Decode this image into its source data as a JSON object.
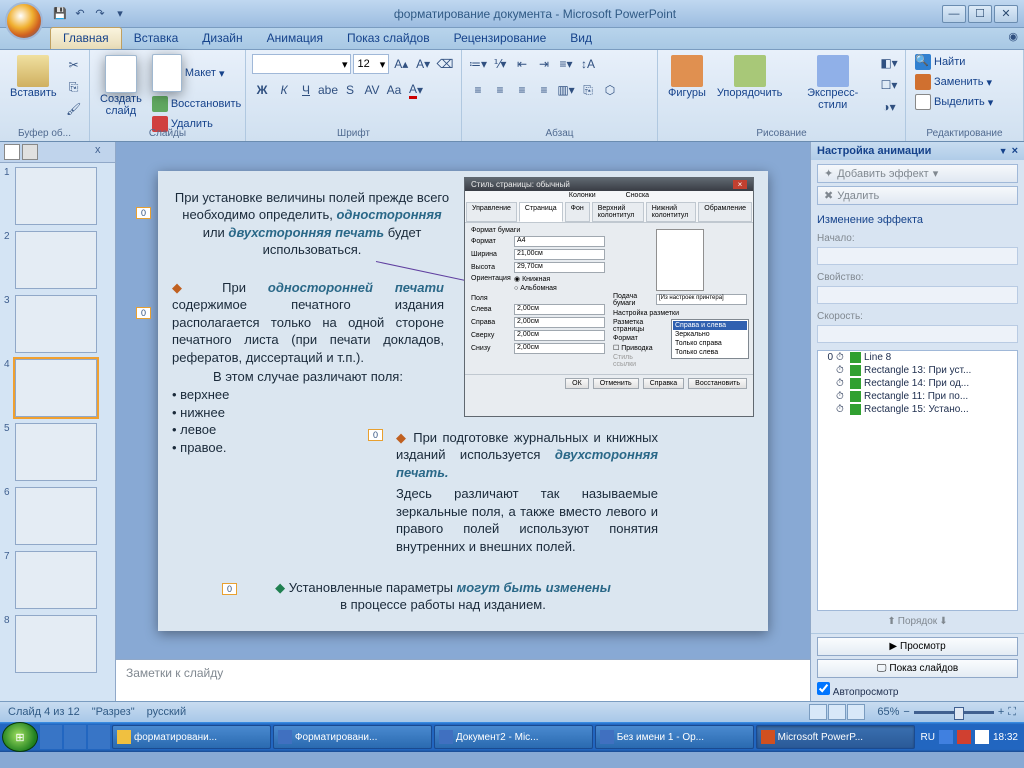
{
  "title": "форматирование документа - Microsoft PowerPoint",
  "qat": {
    "save": "💾",
    "undo": "↶",
    "redo": "↷",
    "dd": "▾"
  },
  "winbtns": {
    "min": "—",
    "max": "☐",
    "close": "✕"
  },
  "tabs": [
    "Главная",
    "Вставка",
    "Дизайн",
    "Анимация",
    "Показ слайдов",
    "Рецензирование",
    "Вид"
  ],
  "ribbon": {
    "clipboard": {
      "label": "Буфер об...",
      "paste": "Вставить"
    },
    "slides": {
      "label": "Слайды",
      "new": "Создать\nслайд",
      "layout": "Макет",
      "reset": "Восстановить",
      "delete": "Удалить"
    },
    "font": {
      "label": "Шрифт",
      "name": "",
      "size": "12"
    },
    "para": {
      "label": "Абзац"
    },
    "draw": {
      "label": "Рисование",
      "shapes": "Фигуры",
      "arrange": "Упорядочить",
      "quick": "Экспресс-стили"
    },
    "edit": {
      "label": "Редактирование",
      "find": "Найти",
      "replace": "Заменить",
      "select": "Выделить"
    }
  },
  "outline": {
    "close": "x"
  },
  "slide_count": 12,
  "selected_slide": 4,
  "slide": {
    "p1a": "При установке величины полей прежде всего необходимо определить, ",
    "p1b": "односторонняя",
    "p1c": " или ",
    "p1d": "двухсторонняя печать",
    "p1e": " будет использоваться.",
    "p2a": "При ",
    "p2b": "односторонней печати",
    "p2c": " содержимое печатного издания располагается только на одной стороне печатного листа (при печати докладов, рефератов, диссертаций и т.п.).",
    "p3": "В этом случае различают поля:",
    "b1": "• верхнее",
    "b2": "• нижнее",
    "b3": "• левое",
    "b4": "• правое.",
    "p4a": "При подготовке журнальных и книжных изданий используется ",
    "p4b": "двухсторонняя печать.",
    "p5": "Здесь различают так называемые зеркальные поля, а также вместо левого и правого полей используют понятия внутренних и внешних полей.",
    "p6a": "Установленные параметры ",
    "p6b": "могут быть изменены",
    "p6c": " в процессе работы над изданием.",
    "tags": [
      "0",
      "0",
      "0",
      "0"
    ]
  },
  "dialog": {
    "title": "Стиль страницы: обычный",
    "tabs": [
      "Управление",
      "Страница",
      "Фон",
      "Верхний колонтитул",
      "Нижний колонтитул",
      "Обрамление"
    ],
    "subtabs_top": "Колонки",
    "subtabs_r": "Сноска",
    "r": {
      "fmt": "Формат бумаги",
      "format": "Формат",
      "fv": "A4",
      "w": "Ширина",
      "wv": "21,00см",
      "h": "Высота",
      "hv": "29,70см",
      "or": "Ориентация",
      "or1": "Книжная",
      "or2": "Альбомная"
    },
    "feed": "Подача бумаги",
    "feedv": "[Из настроек принтера]",
    "margins": "Поля",
    "ml": "Слева",
    "mr": "Справа",
    "mt": "Сверху",
    "mb": "Снизу",
    "mv": "2,00см",
    "layout": "Настройка разметки",
    "pl": "Разметка страницы",
    "fmt2": "Формат",
    "reg": "Приводка",
    "sref": "Стиль ссылки",
    "dd": {
      "sel": "Справа и слева",
      "opts": [
        "Справа и слева",
        "Зеркально",
        "Только справа",
        "Только слева"
      ]
    },
    "btns": {
      "ok": "ОК",
      "cancel": "Отменить",
      "help": "Справка",
      "restore": "Восстановить"
    }
  },
  "notes": "Заметки к слайду",
  "anim": {
    "title": "Настройка анимации",
    "add": "Добавить эффект",
    "del": "Удалить",
    "change": "Изменение эффекта",
    "start": "Начало:",
    "prop": "Свойство:",
    "speed": "Скорость:",
    "items": [
      {
        "n": "0",
        "t": "Line 8",
        "c": "#30a030"
      },
      {
        "n": "",
        "t": "Rectangle 13: При уст...",
        "c": "#30a030"
      },
      {
        "n": "",
        "t": "Rectangle 14:  При од...",
        "c": "#30a030"
      },
      {
        "n": "",
        "t": "Rectangle 11: При по...",
        "c": "#30a030"
      },
      {
        "n": "",
        "t": "Rectangle 15:  Устано...",
        "c": "#30a030"
      }
    ],
    "order": "Порядок",
    "preview": "Просмотр",
    "show": "Показ слайдов",
    "auto": "Автопросмотр"
  },
  "status": {
    "slide": "Слайд 4 из 12",
    "theme": "\"Разрез\"",
    "lang": "русский",
    "zoom": "65%"
  },
  "taskbar": {
    "items": [
      {
        "t": "форматировани...",
        "ic": "#f0c040"
      },
      {
        "t": "Форматировани...",
        "ic": "#4070c0"
      },
      {
        "t": "Документ2 - Mic...",
        "ic": "#4070c0"
      },
      {
        "t": "Без имени 1 - Op...",
        "ic": "#4070c0"
      },
      {
        "t": "Microsoft PowerP...",
        "ic": "#d05020",
        "active": true
      }
    ],
    "lang": "RU",
    "time": "18:32"
  }
}
